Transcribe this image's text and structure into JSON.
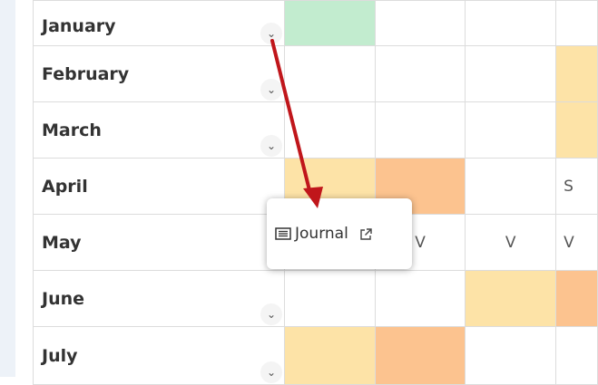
{
  "calendar": {
    "months": [
      {
        "label": "January"
      },
      {
        "label": "February"
      },
      {
        "label": "March"
      },
      {
        "label": "April"
      },
      {
        "label": "May"
      },
      {
        "label": "June"
      },
      {
        "label": "July"
      }
    ],
    "cells": {
      "april_c4": "S",
      "may_c2": "V",
      "may_c3": "V",
      "may_c4": "V"
    }
  },
  "popup": {
    "journal_label": "Journal",
    "journal_icon": "list-icon",
    "open_icon": "external-link-icon"
  },
  "annotation": {
    "arrow_color": "#c0161b"
  },
  "colors": {
    "green": "#c2eccf",
    "yellow": "#fde3a7",
    "orange": "#fcc38f"
  }
}
